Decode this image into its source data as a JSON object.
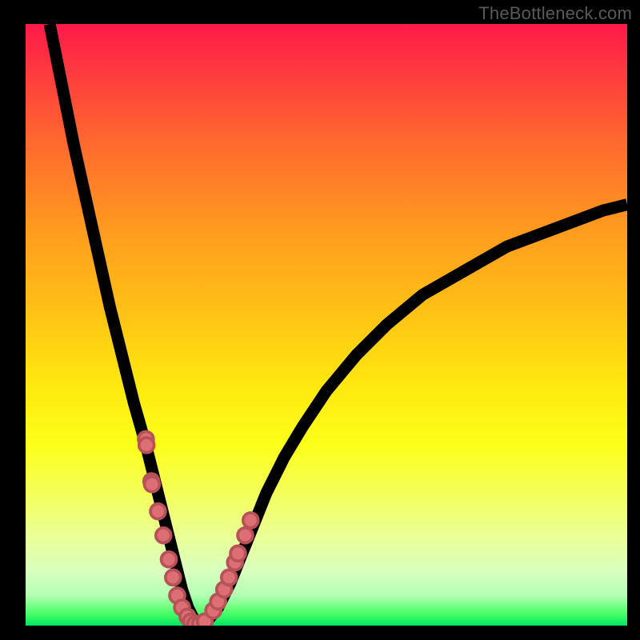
{
  "watermark": "TheBottleneck.com",
  "colors": {
    "bead_fill": "#dd6f74",
    "bead_stroke": "#b85259",
    "curve": "#000000"
  },
  "chart_data": {
    "type": "line",
    "title": "",
    "xlabel": "",
    "ylabel": "",
    "xlim": [
      0,
      100
    ],
    "ylim": [
      0,
      100
    ],
    "series": [
      {
        "name": "bottleneck-curve",
        "x": [
          4,
          6,
          8,
          10,
          12,
          14,
          16,
          18,
          20,
          21,
          22,
          23,
          24,
          25,
          26,
          27,
          28,
          29,
          30,
          32,
          34,
          36,
          38,
          40,
          43,
          46,
          50,
          55,
          60,
          66,
          73,
          80,
          88,
          96,
          100
        ],
        "y": [
          100,
          90,
          80,
          71,
          62,
          53,
          45,
          37,
          30,
          26,
          22,
          18,
          14,
          10,
          6,
          3,
          1,
          0,
          0.5,
          3,
          7,
          12,
          17,
          22,
          28,
          33,
          39,
          45,
          50,
          55,
          59,
          63,
          66,
          69,
          70
        ]
      }
    ],
    "beads": {
      "name": "sample-points",
      "x": [
        20.0,
        20.1,
        20.9,
        21.0,
        22.0,
        22.9,
        23.8,
        24.5,
        25.2,
        26.0,
        26.9,
        27.5,
        28.2,
        29.0,
        29.8,
        31.2,
        32.0,
        33.0,
        33.8,
        34.8,
        35.3,
        36.5,
        37.4
      ],
      "y": [
        31.0,
        30.0,
        24.0,
        23.5,
        19.0,
        15.0,
        11.0,
        8.0,
        5.0,
        3.0,
        1.5,
        0.7,
        0.3,
        0.3,
        0.7,
        2.5,
        4.0,
        6.0,
        8.0,
        10.5,
        12.0,
        15.0,
        17.5
      ]
    }
  }
}
